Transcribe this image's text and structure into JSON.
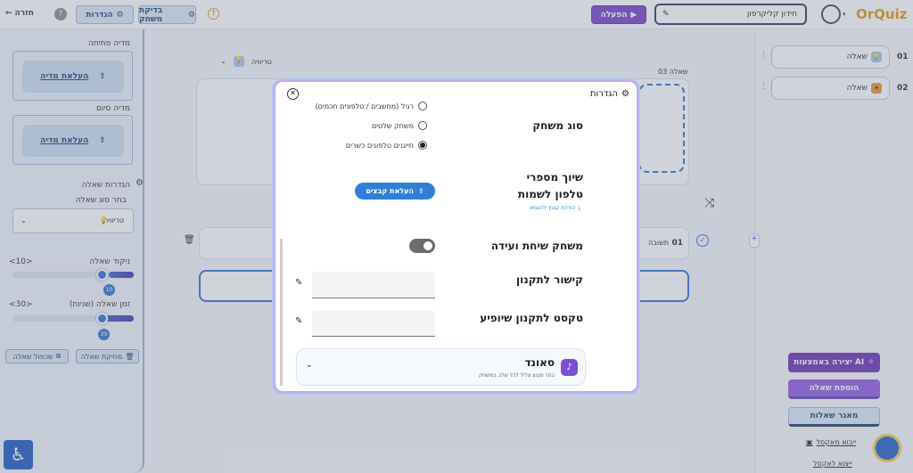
{
  "topbar": {
    "back_label": "חזרה",
    "settings_label": "הגדרות",
    "test_game_label": "בדיקת משחק",
    "activate_label": "הפעלה",
    "game_title_value": "חידון קליקרפון",
    "logo_text": "OrQuiz"
  },
  "left_panel": {
    "opening_media_label": "מדיה פתיחה",
    "opening_upload_label": "העלאת מדיה",
    "closing_media_label": "מדיה סיום",
    "closing_upload_label": "העלאת מדיה",
    "question_settings_label": "הגדרות שאלה",
    "choose_type_label": "בחר סוג שאלה",
    "question_type_value": "טריוויה",
    "score_label": "ניקוד שאלה",
    "score_range_text": "<10>",
    "score_value": "10",
    "score_fraction": 0.2,
    "time_label": "זמן שאלה (שניות)",
    "time_range_text": "<30>",
    "time_value": "30",
    "time_fraction": 0.28,
    "duplicate_label": "שכפול שאלה",
    "delete_label": "מחיקת שאלה"
  },
  "main": {
    "question_type_label": "טריוויה",
    "question_number_label": "שאלה 03",
    "answer_label": "תשובה",
    "answer_number": "01"
  },
  "right_panel": {
    "questions": [
      {
        "number": "01",
        "label": "שאלה"
      },
      {
        "number": "02",
        "label": "שאלה"
      }
    ],
    "ai_create_label": "יצירה באמצעות AI",
    "add_question_label": "הוספת שאלה",
    "question_bank_label": "מאגר שאלות",
    "import_excel_label": "ייבוא מאקסל",
    "export_excel_label": "ייצוא לאקסל"
  },
  "modal": {
    "title": "הגדרות",
    "game_type_label": "סוג משחק",
    "game_type_options": [
      {
        "label": "רגיל (מחשבים / טלפונים חכמים)",
        "selected": false
      },
      {
        "label": "משחק שלטים",
        "selected": false
      },
      {
        "label": "חייגנים טלפונים כשרים",
        "selected": true
      }
    ],
    "phone_mapping_label_line1": "שיוך מספרי",
    "phone_mapping_label_line2": "טלפון לשמות",
    "upload_files_label": "העלאת קבצים",
    "download_example_label": "הורדת קובץ לדוגמא",
    "chat_game_label": "משחק שיחת ועידה",
    "chat_game_enabled": true,
    "regulation_link_label": "קישור לתקנון",
    "regulation_link_value": "",
    "regulation_text_label": "טקסט לתקנון שיופיע",
    "regulation_text_value": "",
    "sound_title": "סאונד",
    "sound_subtitle": "בחר סגנון צליל לכל שלב במשחק"
  },
  "colors": {
    "primary_blue": "#2f6fcf",
    "purple": "#7540c7",
    "logo_gold": "#d89b12"
  }
}
